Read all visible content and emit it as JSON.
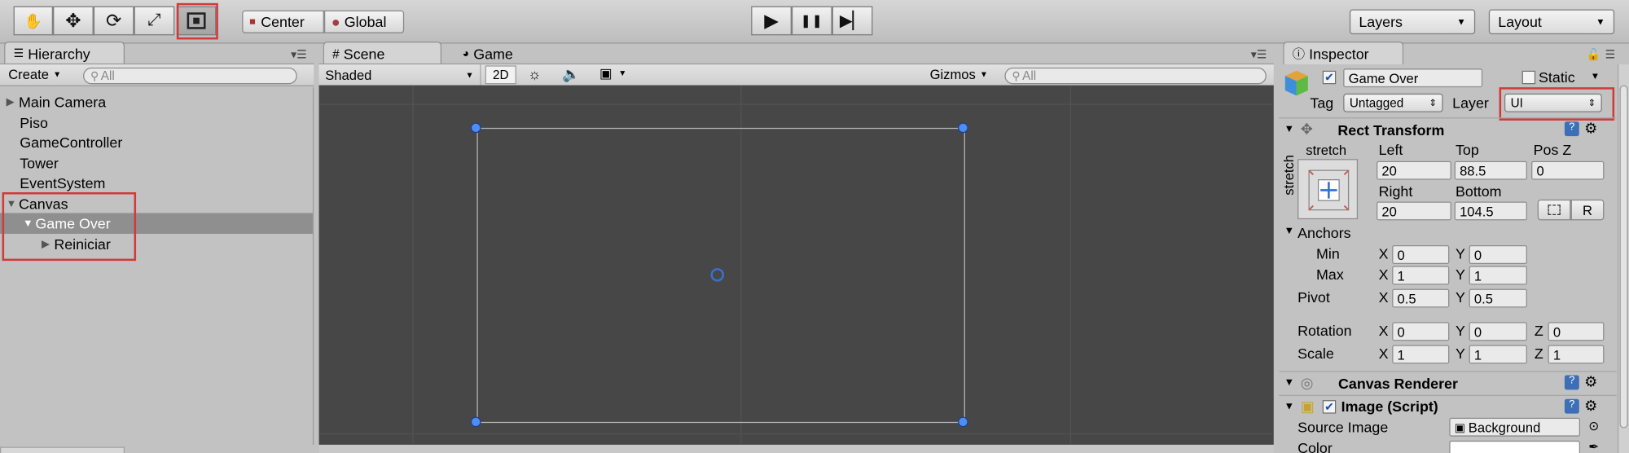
{
  "toolbar": {
    "tools": [
      "hand-tool",
      "move-tool",
      "rotate-tool",
      "scale-tool",
      "rect-tool"
    ],
    "pivot_label": "Center",
    "space_label": "Global",
    "play_icon": "▶",
    "pause_icon": "❚❚",
    "step_icon": "▶▏",
    "layers_label": "Layers",
    "layout_label": "Layout"
  },
  "hierarchy": {
    "tab_label": "Hierarchy",
    "create_label": "Create",
    "search_placeholder": "All",
    "items": [
      {
        "label": "Main Camera",
        "expander": "▶"
      },
      {
        "label": "Piso"
      },
      {
        "label": "GameController"
      },
      {
        "label": "Tower"
      },
      {
        "label": "EventSystem"
      },
      {
        "label": "Canvas",
        "expander": "▼"
      },
      {
        "label": "Game Over",
        "expander": "▼",
        "selected": true
      },
      {
        "label": "Reiniciar",
        "expander": "▶"
      }
    ]
  },
  "scene": {
    "tab_scene": "Scene",
    "tab_game": "Game",
    "shading": "Shaded",
    "mode_2d": "2D",
    "gizmos": "Gizmos",
    "search_placeholder": "All"
  },
  "inspector": {
    "tab_label": "Inspector",
    "object_name": "Game Over",
    "static_label": "Static",
    "tag_label": "Tag",
    "tag_value": "Untagged",
    "layer_label": "Layer",
    "layer_value": "UI",
    "rect_transform": {
      "title": "Rect Transform",
      "stretch_h": "stretch",
      "stretch_v": "stretch",
      "left_label": "Left",
      "left": "20",
      "top_label": "Top",
      "top": "88.5",
      "posz_label": "Pos Z",
      "posz": "0",
      "right_label": "Right",
      "right": "20",
      "bottom_label": "Bottom",
      "bottom": "104.5",
      "r_button": "R",
      "anchors_label": "Anchors",
      "min_label": "Min",
      "min_x": "0",
      "min_y": "0",
      "max_label": "Max",
      "max_x": "1",
      "max_y": "1",
      "pivot_label": "Pivot",
      "pivot_x": "0.5",
      "pivot_y": "0.5",
      "rotation_label": "Rotation",
      "rot_x": "0",
      "rot_y": "0",
      "rot_z": "0",
      "scale_label": "Scale",
      "scale_x": "1",
      "scale_y": "1",
      "scale_z": "1",
      "x": "X",
      "y": "Y",
      "z": "Z"
    },
    "canvas_renderer": "Canvas Renderer",
    "image_script": "Image (Script)",
    "source_image_label": "Source Image",
    "source_image_value": "Background",
    "color_label": "Color"
  },
  "colors": {
    "highlight_box": "#d23a3a",
    "selection": "#8f8f8f",
    "scene_bg": "#474747",
    "handle": "#4e8ef4"
  }
}
